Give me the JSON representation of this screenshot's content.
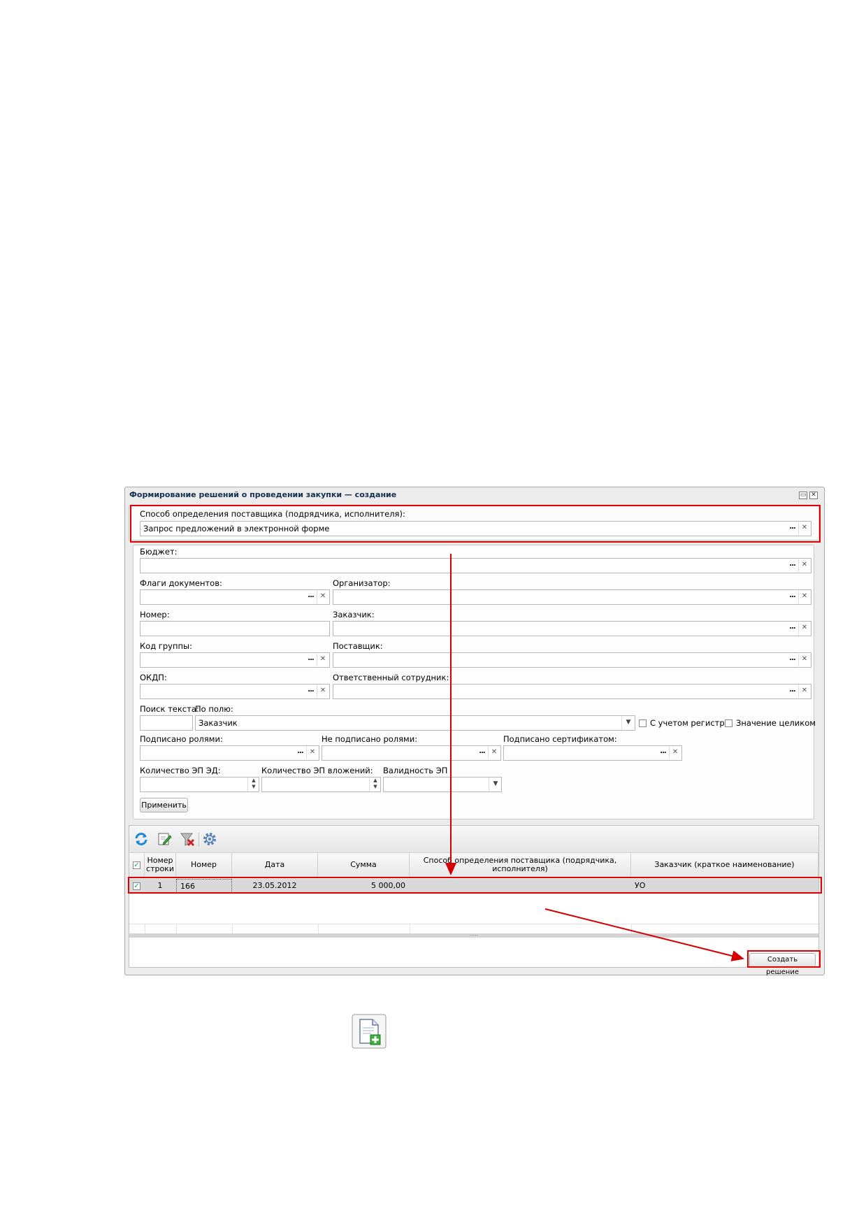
{
  "window": {
    "title": "Формирование решений о проведении закупки — создание",
    "colors": {
      "highlight": "#e00000",
      "arrow": "#d40000"
    }
  },
  "method": {
    "label": "Способ определения поставщика (подрядчика, исполнителя):",
    "value": "Запрос предложений в электронной форме"
  },
  "filters": {
    "budget": {
      "label": "Бюджет:",
      "value": ""
    },
    "flags": {
      "label": "Флаги документов:",
      "value": ""
    },
    "organizer": {
      "label": "Организатор:",
      "value": ""
    },
    "number": {
      "label": "Номер:",
      "value": ""
    },
    "customer": {
      "label": "Заказчик:",
      "value": ""
    },
    "group_code": {
      "label": "Код группы:",
      "value": ""
    },
    "supplier": {
      "label": "Поставщик:",
      "value": ""
    },
    "okdp": {
      "label": "ОКДП:",
      "value": ""
    },
    "responsible": {
      "label": "Ответственный сотрудник:",
      "value": ""
    },
    "search_text": {
      "label": "Поиск текста:",
      "value": ""
    },
    "by_field": {
      "label": "По полю:",
      "value": "Заказчик"
    },
    "case_sensitive": {
      "label": "С учетом регистра",
      "checked": false
    },
    "whole_value": {
      "label": "Значение целиком",
      "checked": false
    },
    "signed_roles": {
      "label": "Подписано ролями:",
      "value": ""
    },
    "not_signed_roles": {
      "label": "Не подписано ролями:",
      "value": ""
    },
    "signed_cert": {
      "label": "Подписано сертификатом:",
      "value": ""
    },
    "ep_count_ed": {
      "label": "Количество ЭП ЭД:",
      "value": ""
    },
    "ep_count_att": {
      "label": "Количество ЭП вложений:",
      "value": ""
    },
    "ep_validity": {
      "label": "Валидность ЭП",
      "value": ""
    },
    "apply_label": "Применить"
  },
  "toolbar": {
    "icons": [
      "refresh-icon",
      "edit-icon",
      "clear-filter-icon",
      "settings-icon"
    ]
  },
  "grid": {
    "columns": [
      "Номер строки",
      "Номер",
      "Дата",
      "Сумма",
      "Способ определения поставщика (подрядчика, исполнителя)",
      "Заказчик (краткое наименование)"
    ],
    "rows": [
      {
        "checked": true,
        "line": "1",
        "number": "166",
        "date": "23.05.2012",
        "sum": "5 000,00",
        "method": "",
        "customer": "УО"
      }
    ],
    "splitter": "....."
  },
  "footer": {
    "create_label": "Создать решение"
  },
  "below": {
    "icon": "add-document-icon"
  }
}
